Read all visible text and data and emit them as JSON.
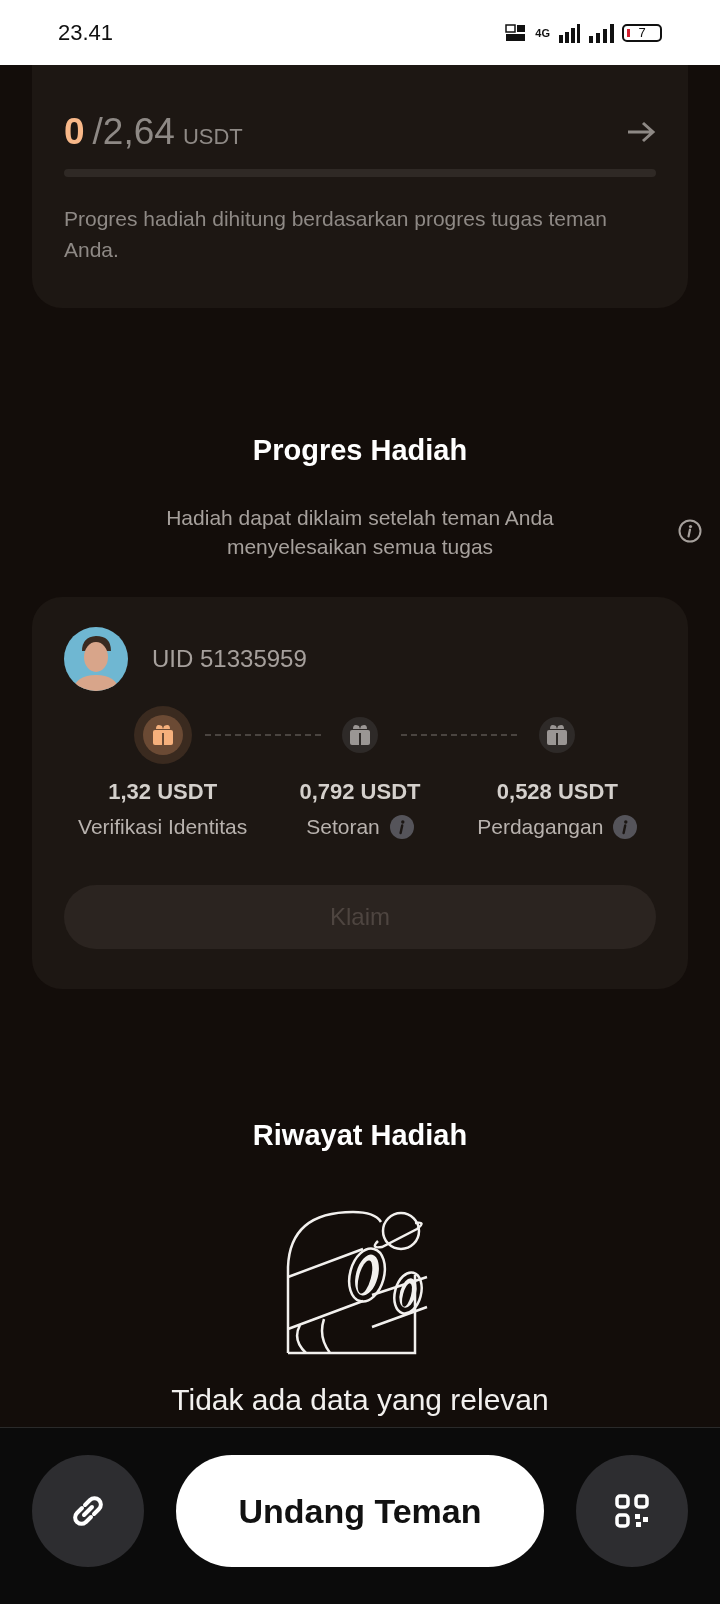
{
  "status_bar": {
    "time": "23.41",
    "network_label": "4G",
    "battery": "7"
  },
  "progress_card": {
    "current": "0",
    "total": "/2,64",
    "unit": "USDT",
    "level": 0,
    "note": "Progres hadiah dihitung berdasarkan progres tugas teman Anda."
  },
  "reward_progress": {
    "title": "Progres Hadiah",
    "subtitle": "Hadiah dapat diklaim setelah teman Anda menyelesaikan semua tugas",
    "friend": {
      "uid": "UID 51335959",
      "tasks": [
        {
          "amount": "1,32 USDT",
          "label": "Verifikasi Identitas",
          "reached": true,
          "has_info": false
        },
        {
          "amount": "0,792 USDT",
          "label": "Setoran",
          "reached": false,
          "has_info": true
        },
        {
          "amount": "0,528 USDT",
          "label": "Perdagangan",
          "reached": false,
          "has_info": true
        }
      ],
      "claim_button": {
        "label": "Klaim",
        "disabled": true
      }
    }
  },
  "reward_history": {
    "title": "Riwayat Hadiah",
    "empty_text": "Tidak ada data yang relevan"
  },
  "bottom_bar": {
    "invite_button": "Undang Teman"
  }
}
